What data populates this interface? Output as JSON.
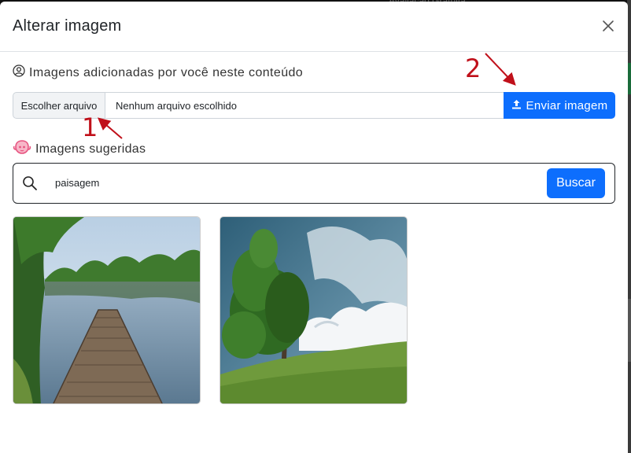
{
  "background": {
    "partial_text": "Avaliação Gratuita"
  },
  "modal": {
    "title": "Alterar imagem",
    "close_icon": "close-icon"
  },
  "user_images": {
    "label": "Imagens adicionadas por você neste conteúdo",
    "icon": "user-circle-icon",
    "file_choose_label": "Escolher arquivo",
    "file_status": "Nenhum arquivo escolhido",
    "upload_label": "Enviar imagem",
    "upload_icon": "upload-icon"
  },
  "suggested": {
    "label": "Imagens sugeridas",
    "icon": "mascot-icon",
    "search_icon": "search-icon",
    "search_value": "paisagem",
    "search_button": "Buscar",
    "images": [
      {
        "subject": "wooden pier on lake with trees"
      },
      {
        "subject": "tree on grassy hill under cloudy sky"
      }
    ]
  },
  "annotations": {
    "one": "1",
    "two": "2"
  },
  "colors": {
    "primary": "#0d6efd",
    "annotation": "#c0101a",
    "mascot": "#e75480"
  }
}
